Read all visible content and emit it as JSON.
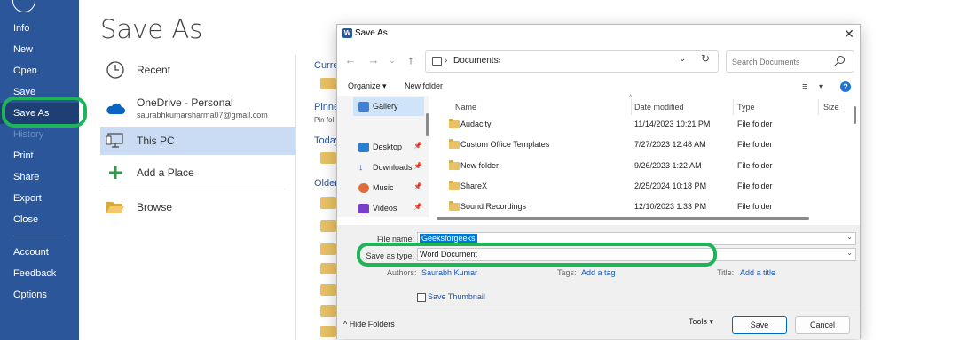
{
  "nav": {
    "items": [
      "Info",
      "New",
      "Open",
      "Save",
      "Save As",
      "History",
      "Print",
      "Share",
      "Export",
      "Close",
      "Account",
      "Feedback",
      "Options"
    ]
  },
  "page": {
    "title": "Save As",
    "locations": [
      {
        "label": "Recent",
        "icon": "clock-icon"
      },
      {
        "label": "OneDrive - Personal",
        "sublabel": "saurabhkumarsharma07@gmail.com",
        "icon": "cloud-icon"
      },
      {
        "label": "This PC",
        "icon": "computer-icon"
      },
      {
        "label": "Add a Place",
        "icon": "plus-icon"
      },
      {
        "label": "Browse",
        "icon": "folder-open-icon"
      }
    ],
    "right_pane": {
      "heading_1": "Curre",
      "heading_2": "Pinne",
      "sub_2": "Pin fol",
      "heading_3": "Today",
      "heading_4": "Older"
    }
  },
  "dialog": {
    "title": "Save As",
    "close_glyph": "✕",
    "address": {
      "crumb": "Documents"
    },
    "search_placeholder": "Search Documents",
    "toolbar": {
      "organize": "Organize ▾",
      "new_folder": "New folder"
    },
    "nav_pane": [
      {
        "label": "Gallery",
        "icon": "gallery-icon",
        "pinned": false
      },
      {
        "label": "Desktop",
        "icon": "desktop-icon",
        "pinned": true
      },
      {
        "label": "Downloads",
        "icon": "download-icon",
        "pinned": true
      },
      {
        "label": "Music",
        "icon": "music-icon",
        "pinned": true
      },
      {
        "label": "Videos",
        "icon": "video-icon",
        "pinned": true
      }
    ],
    "columns": [
      "Name",
      "Date modified",
      "Type",
      "Size"
    ],
    "files": [
      {
        "name": "Audacity",
        "date": "11/14/2023 10:21 PM",
        "type": "File folder"
      },
      {
        "name": "Custom Office Templates",
        "date": "7/27/2023 12:48 AM",
        "type": "File folder"
      },
      {
        "name": "New folder",
        "date": "9/26/2023 1:22 AM",
        "type": "File folder"
      },
      {
        "name": "ShareX",
        "date": "2/25/2024 10:18 PM",
        "type": "File folder"
      },
      {
        "name": "Sound Recordings",
        "date": "12/10/2023 1:33 PM",
        "type": "File folder"
      }
    ],
    "form": {
      "file_name_label": "File name:",
      "file_name_value": "Geeksforgeeks",
      "save_type_label": "Save as type:",
      "save_type_value": "Word Document",
      "authors_label": "Authors:",
      "authors_value": "Saurabh Kumar",
      "tags_label": "Tags:",
      "tags_value": "Add a tag",
      "title_label": "Title:",
      "title_value": "Add a title",
      "thumbnail_label": "Save Thumbnail"
    },
    "footer": {
      "hide_folders": "Hide Folders",
      "tools": "Tools",
      "save": "Save",
      "cancel": "Cancel"
    }
  },
  "colors": {
    "nav_bg": "#2b579a",
    "highlight": "#1fb35a",
    "selection": "#c9dcf3",
    "accent": "#0067c0"
  }
}
